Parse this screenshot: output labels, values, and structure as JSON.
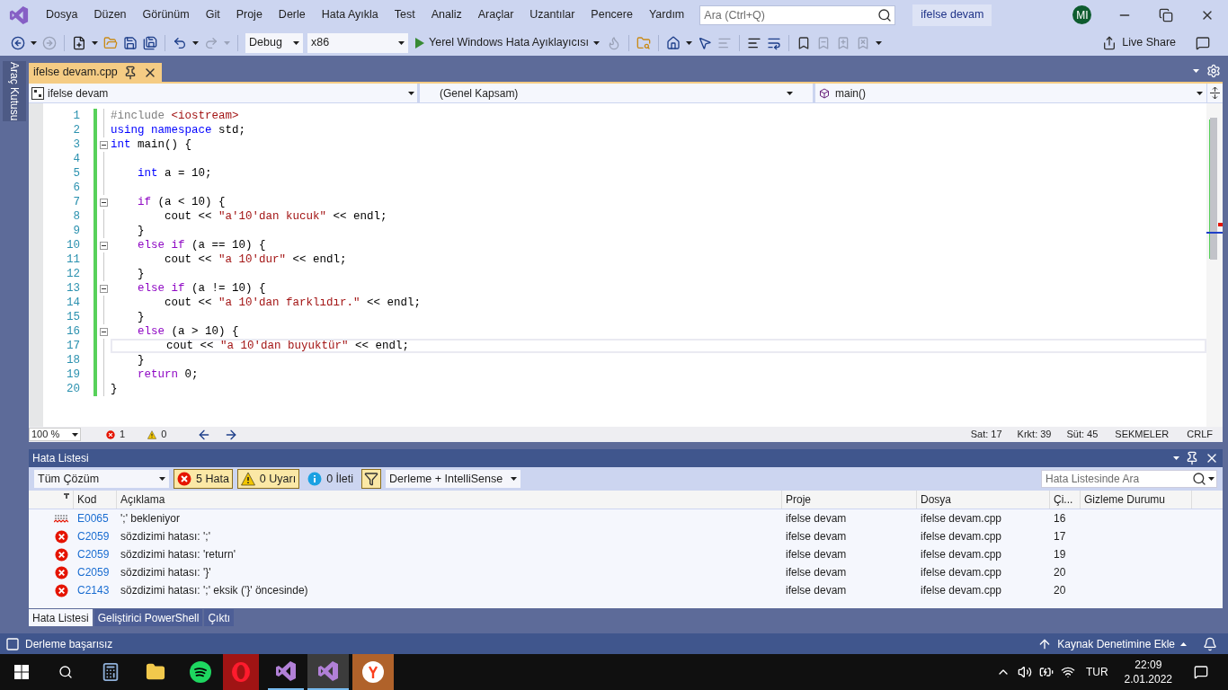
{
  "menu": [
    "Dosya",
    "Düzen",
    "Görünüm",
    "Git",
    "Proje",
    "Derle",
    "Hata Ayıkla",
    "Test",
    "Analiz",
    "Araçlar",
    "Uzantılar",
    "Pencere",
    "Yardım"
  ],
  "search": {
    "placeholder": "Ara (Ctrl+Q)"
  },
  "solution_name": "ifelse devam",
  "avatar": "MI",
  "toolbar": {
    "configuration": "Debug",
    "platform": "x86",
    "run": "Yerel Windows Hata Ayıklayıcısı",
    "live_share": "Live Share"
  },
  "toolbox_tab": "Araç Kutusu",
  "document_tab": {
    "title": "ifelse devam.cpp",
    "selected": true
  },
  "navigation": {
    "project": "ifelse devam",
    "scope": "(Genel Kapsam)",
    "member": "main()"
  },
  "code_lines": [
    {
      "number": "1",
      "fold": false,
      "current": false,
      "tokens": [
        {
          "kind": "pre",
          "text": "#include"
        },
        {
          "kind": "str",
          "text": " <iostream>"
        }
      ]
    },
    {
      "number": "2",
      "fold": false,
      "current": false,
      "tokens": [
        {
          "kind": "kw",
          "text": "using"
        },
        {
          "kind": "kw",
          "text": " namespace"
        },
        {
          "kind": "plain",
          "text": " std;"
        }
      ]
    },
    {
      "number": "3",
      "fold": true,
      "current": false,
      "tokens": [
        {
          "kind": "kw",
          "text": "int"
        },
        {
          "kind": "plain",
          "text": " main() {"
        }
      ]
    },
    {
      "number": "4",
      "fold": false,
      "current": false
    },
    {
      "number": "5",
      "fold": false,
      "current": false,
      "tokens": [
        {
          "kind": "kw",
          "text": "    int"
        },
        {
          "kind": "plain",
          "text": " a = 10;"
        }
      ]
    },
    {
      "number": "6",
      "fold": false,
      "current": false
    },
    {
      "number": "7",
      "fold": true,
      "current": false,
      "tokens": [
        {
          "kind": "ctrl",
          "text": "    if"
        },
        {
          "kind": "plain",
          "text": " (a < 10) {"
        }
      ]
    },
    {
      "number": "8",
      "fold": false,
      "current": false,
      "tokens": [
        {
          "kind": "plain",
          "text": "        cout << "
        },
        {
          "kind": "str",
          "text": "\"a'10'dan kucuk\""
        },
        {
          "kind": "plain",
          "text": " << endl;"
        }
      ]
    },
    {
      "number": "9",
      "fold": false,
      "current": false,
      "tokens": [
        {
          "kind": "plain",
          "text": "    }"
        }
      ]
    },
    {
      "number": "10",
      "fold": true,
      "current": false,
      "tokens": [
        {
          "kind": "ctrl",
          "text": "    else"
        },
        {
          "kind": "ctrl",
          "text": " if"
        },
        {
          "kind": "plain",
          "text": " (a == 10) {"
        }
      ]
    },
    {
      "number": "11",
      "fold": false,
      "current": false,
      "tokens": [
        {
          "kind": "plain",
          "text": "        cout << "
        },
        {
          "kind": "str",
          "text": "\"a 10'dur\""
        },
        {
          "kind": "plain",
          "text": " << endl;"
        }
      ]
    },
    {
      "number": "12",
      "fold": false,
      "current": false,
      "tokens": [
        {
          "kind": "plain",
          "text": "    }"
        }
      ]
    },
    {
      "number": "13",
      "fold": true,
      "current": false,
      "tokens": [
        {
          "kind": "ctrl",
          "text": "    else"
        },
        {
          "kind": "ctrl",
          "text": " if"
        },
        {
          "kind": "plain",
          "text": " (a != 10) {"
        }
      ]
    },
    {
      "number": "14",
      "fold": false,
      "current": false,
      "tokens": [
        {
          "kind": "plain",
          "text": "        cout << "
        },
        {
          "kind": "str",
          "text": "\"a 10'dan farklıdır.\""
        },
        {
          "kind": "plain",
          "text": " << endl;"
        }
      ]
    },
    {
      "number": "15",
      "fold": false,
      "current": false,
      "tokens": [
        {
          "kind": "plain",
          "text": "    }"
        }
      ]
    },
    {
      "number": "16",
      "fold": true,
      "current": false,
      "tokens": [
        {
          "kind": "ctrl",
          "text": "    else"
        },
        {
          "kind": "plain",
          "text": " (a > 10) {"
        }
      ]
    },
    {
      "number": "17",
      "fold": false,
      "current": true,
      "tokens": [
        {
          "kind": "plain",
          "text": "        cout << "
        },
        {
          "kind": "str",
          "text": "\"a 10'dan buyuktür\""
        },
        {
          "kind": "plain",
          "text": " << endl;"
        }
      ]
    },
    {
      "number": "18",
      "fold": false,
      "current": false,
      "tokens": [
        {
          "kind": "plain",
          "text": "    }"
        }
      ]
    },
    {
      "number": "19",
      "fold": false,
      "current": false,
      "tokens": [
        {
          "kind": "ctrl",
          "text": "    return"
        },
        {
          "kind": "plain",
          "text": " 0;"
        }
      ]
    },
    {
      "number": "20",
      "fold": false,
      "current": false,
      "tokens": [
        {
          "kind": "plain",
          "text": "}"
        }
      ]
    }
  ],
  "editor_status": {
    "zoom": "100 %",
    "errors": "1",
    "warnings": "0",
    "line": "Sat: 17",
    "char": "Krkt: 39",
    "column": "Süt: 45",
    "indent": "SEKMELER",
    "line_ending": "CRLF"
  },
  "error_list": {
    "title": "Hata Listesi",
    "scope": "Tüm Çözüm",
    "filters": [
      {
        "kind": "error",
        "label": "5 Hata",
        "on": true
      },
      {
        "kind": "warning",
        "label": "0 Uyarı",
        "on": true
      },
      {
        "kind": "info",
        "label": "0 İleti",
        "on": false
      }
    ],
    "filter_toggle": {
      "on": true
    },
    "source": "Derleme + IntelliSense",
    "search": {
      "placeholder": "Hata Listesinde Ara"
    },
    "columns": [
      "Kod",
      "Açıklama",
      "Proje",
      "Dosya",
      "Çi...",
      "Gizleme Durumu"
    ],
    "rows": [
      {
        "kind": "intellisense",
        "code": "E0065",
        "description": "';' bekleniyor",
        "project": "ifelse devam",
        "file": "ifelse devam.cpp",
        "line": "16"
      },
      {
        "kind": "error",
        "code": "C2059",
        "description": "sözdizimi hatası: ';'",
        "project": "ifelse devam",
        "file": "ifelse devam.cpp",
        "line": "17"
      },
      {
        "kind": "error",
        "code": "C2059",
        "description": "sözdizimi hatası: 'return'",
        "project": "ifelse devam",
        "file": "ifelse devam.cpp",
        "line": "19"
      },
      {
        "kind": "error",
        "code": "C2059",
        "description": "sözdizimi hatası: '}'",
        "project": "ifelse devam",
        "file": "ifelse devam.cpp",
        "line": "20"
      },
      {
        "kind": "error",
        "code": "C2143",
        "description": "sözdizimi hatası: ';' eksik ('}' öncesinde)",
        "project": "ifelse devam",
        "file": "ifelse devam.cpp",
        "line": "20"
      }
    ]
  },
  "panel_tabs": [
    {
      "label": "Hata Listesi",
      "selected": true
    },
    {
      "label": "Geliştirici PowerShell",
      "selected": false
    },
    {
      "label": "Çıktı",
      "selected": false
    }
  ],
  "status_bar": {
    "message": "Derleme başarısız",
    "source_control": "Kaynak Denetimine Ekle"
  },
  "taskbar": {
    "language": "TUR",
    "time": "22:09",
    "date": "2.01.2022"
  }
}
